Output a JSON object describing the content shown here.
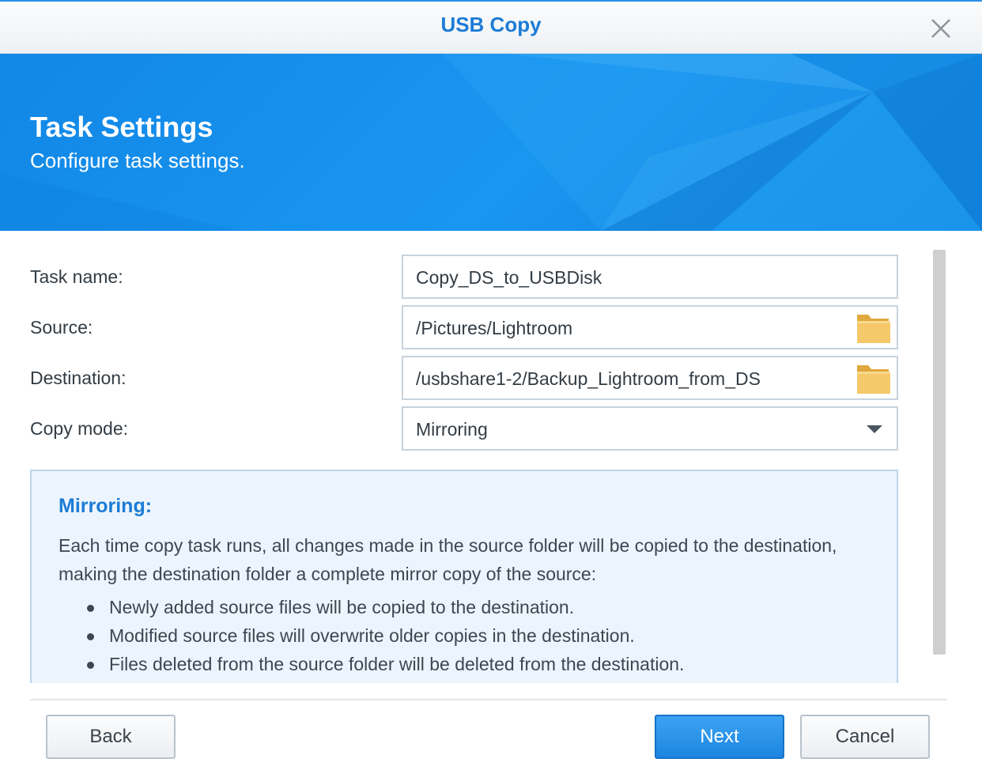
{
  "window": {
    "title": "USB Copy"
  },
  "banner": {
    "title": "Task Settings",
    "subtitle": "Configure task settings."
  },
  "form": {
    "task_name": {
      "label": "Task name:",
      "value": "Copy_DS_to_USBDisk"
    },
    "source": {
      "label": "Source:",
      "value": "/Pictures/Lightroom"
    },
    "destination": {
      "label": "Destination:",
      "value": "/usbshare1-2/Backup_Lightroom_from_DS"
    },
    "copy_mode": {
      "label": "Copy mode:",
      "value": "Mirroring"
    }
  },
  "info": {
    "title": "Mirroring:",
    "text": "Each time copy task runs, all changes made in the source folder will be copied to the destination, making the destination folder a complete mirror copy of the source:",
    "bullets": [
      "Newly added source files will be copied to the destination.",
      "Modified source files will overwrite older copies in the destination.",
      "Files deleted from the source folder will be deleted from the destination."
    ]
  },
  "footer": {
    "back_label": "Back",
    "next_label": "Next",
    "cancel_label": "Cancel"
  },
  "colors": {
    "accent": "#1c7cd6",
    "banner": "#1996f0",
    "primary_button": "#1b85e0",
    "folder": "#f5c86a",
    "info_bg": "#ecf5fd"
  },
  "icons": {
    "close": "close-icon",
    "folder": "folder-icon",
    "dropdown": "chevron-down-icon"
  }
}
